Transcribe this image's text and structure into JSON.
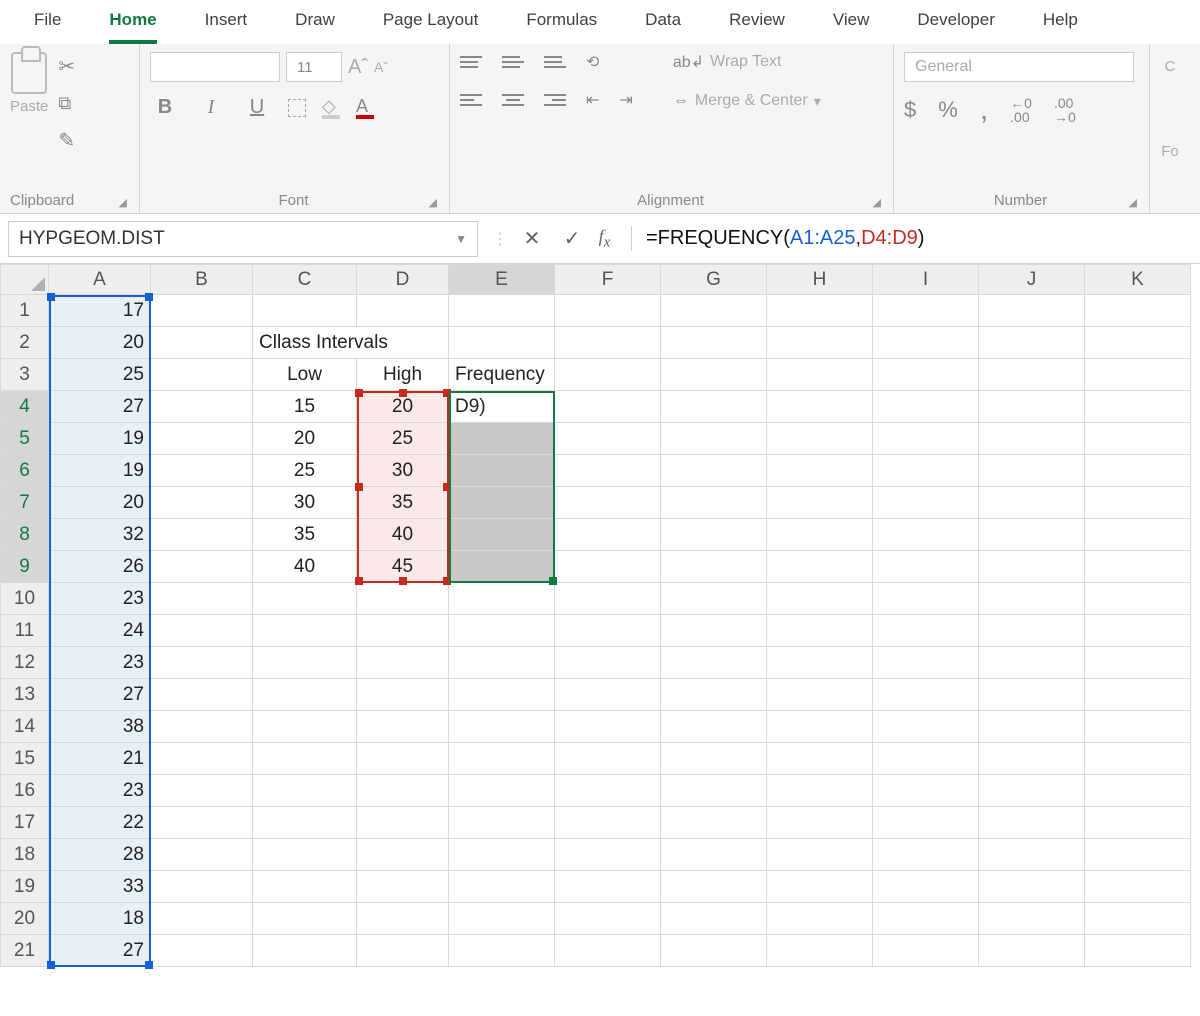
{
  "tabs": {
    "file": "File",
    "home": "Home",
    "insert": "Insert",
    "draw": "Draw",
    "pagelayout": "Page Layout",
    "formulas": "Formulas",
    "data": "Data",
    "review": "Review",
    "view": "View",
    "developer": "Developer",
    "help": "Help"
  },
  "ribbon": {
    "clipboard": {
      "paste": "Paste",
      "label": "Clipboard"
    },
    "font": {
      "name": "",
      "size": "11",
      "bold": "B",
      "italic": "I",
      "underline": "U",
      "fontcolor": "A",
      "label": "Font",
      "increase": "A",
      "decrease": "A"
    },
    "alignment": {
      "wrap": "Wrap Text",
      "merge": "Merge & Center",
      "label": "Alignment"
    },
    "number": {
      "format": "General",
      "currency": "$",
      "percent": "%",
      "comma": ",",
      "decinc": ".00",
      "decdec": ".00",
      "label": "Number"
    },
    "cond": {
      "label1": "C",
      "label2": "Fo"
    }
  },
  "namebox": "HYPGEOM.DIST",
  "formula": {
    "prefix": "=FREQUENCY(",
    "arg1": "A1:A25",
    "comma": ",",
    "arg2": "D4:D9",
    "suffix": ")"
  },
  "columns": [
    "A",
    "B",
    "C",
    "D",
    "E",
    "F",
    "G",
    "H",
    "I",
    "J",
    "K"
  ],
  "cells": {
    "C2": "Cllass Intervals",
    "C3": "Low",
    "D3": "High",
    "E3": "Frequency",
    "C4": "15",
    "C5": "20",
    "C6": "25",
    "C7": "30",
    "C8": "35",
    "C9": "40",
    "D4": "20",
    "D5": "25",
    "D6": "30",
    "D7": "35",
    "D8": "40",
    "D9": "45",
    "E4": "D9)",
    "A1": "17",
    "A2": "20",
    "A3": "25",
    "A4": "27",
    "A5": "19",
    "A6": "19",
    "A7": "20",
    "A8": "32",
    "A9": "26",
    "A10": "23",
    "A11": "24",
    "A12": "23",
    "A13": "27",
    "A14": "38",
    "A15": "21",
    "A16": "23",
    "A17": "22",
    "A18": "28",
    "A19": "33",
    "A20": "18",
    "A21": "27"
  },
  "chart_data": {
    "type": "table",
    "title": "Cllass Intervals",
    "series": [
      {
        "name": "Low",
        "values": [
          15,
          20,
          25,
          30,
          35,
          40
        ]
      },
      {
        "name": "High",
        "values": [
          20,
          25,
          30,
          35,
          40,
          45
        ]
      }
    ],
    "raw_data_A": [
      17,
      20,
      25,
      27,
      19,
      19,
      20,
      32,
      26,
      23,
      24,
      23,
      27,
      38,
      21,
      23,
      22,
      28,
      33,
      18,
      27
    ],
    "formula": "=FREQUENCY(A1:A25,D4:D9)"
  }
}
